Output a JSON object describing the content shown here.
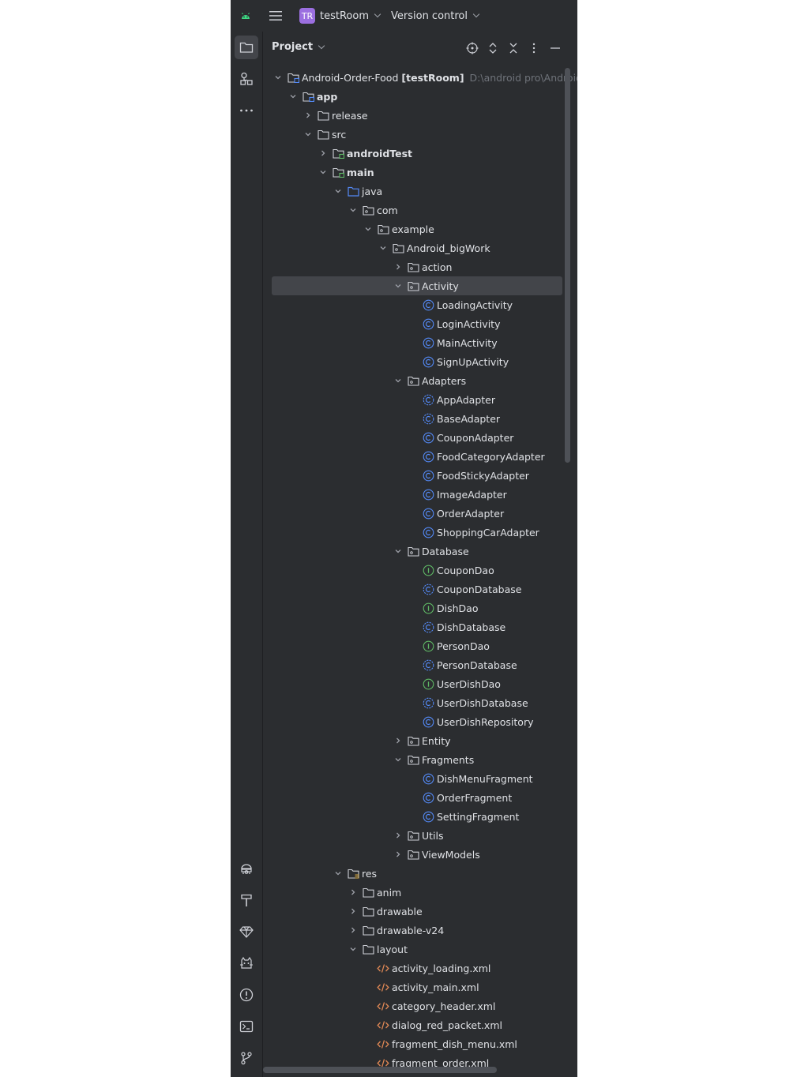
{
  "titlebar": {
    "project_badge": "TR",
    "project_name": "testRoom",
    "vcs_label": "Version control"
  },
  "panel": {
    "title": "Project"
  },
  "tree": [
    {
      "depth": 0,
      "arrow": "down",
      "icon": "module-folder",
      "label": "Android-Order-Food",
      "extra": "[testRoom]",
      "path": "D:\\android pro\\Android"
    },
    {
      "depth": 1,
      "arrow": "down",
      "icon": "module-folder",
      "label": "app",
      "bold": true
    },
    {
      "depth": 2,
      "arrow": "right",
      "icon": "folder",
      "label": "release"
    },
    {
      "depth": 2,
      "arrow": "down",
      "icon": "folder",
      "label": "src"
    },
    {
      "depth": 3,
      "arrow": "right",
      "icon": "source-folder",
      "label": "androidTest",
      "bold": true
    },
    {
      "depth": 3,
      "arrow": "down",
      "icon": "source-folder",
      "label": "main",
      "bold": true
    },
    {
      "depth": 4,
      "arrow": "down",
      "icon": "java-folder",
      "label": "java"
    },
    {
      "depth": 5,
      "arrow": "down",
      "icon": "package",
      "label": "com"
    },
    {
      "depth": 6,
      "arrow": "down",
      "icon": "package",
      "label": "example"
    },
    {
      "depth": 7,
      "arrow": "down",
      "icon": "package",
      "label": "Android_bigWork"
    },
    {
      "depth": 8,
      "arrow": "right",
      "icon": "package",
      "label": "action"
    },
    {
      "depth": 8,
      "arrow": "down",
      "icon": "package",
      "label": "Activity",
      "selected": true
    },
    {
      "depth": 9,
      "arrow": "none",
      "icon": "class",
      "label": "LoadingActivity"
    },
    {
      "depth": 9,
      "arrow": "none",
      "icon": "class",
      "label": "LoginActivity"
    },
    {
      "depth": 9,
      "arrow": "none",
      "icon": "class",
      "label": "MainActivity"
    },
    {
      "depth": 9,
      "arrow": "none",
      "icon": "class",
      "label": "SignUpActivity"
    },
    {
      "depth": 8,
      "arrow": "down",
      "icon": "package",
      "label": "Adapters"
    },
    {
      "depth": 9,
      "arrow": "none",
      "icon": "abstract-class",
      "label": "AppAdapter"
    },
    {
      "depth": 9,
      "arrow": "none",
      "icon": "abstract-class",
      "label": "BaseAdapter"
    },
    {
      "depth": 9,
      "arrow": "none",
      "icon": "class",
      "label": "CouponAdapter"
    },
    {
      "depth": 9,
      "arrow": "none",
      "icon": "class",
      "label": "FoodCategoryAdapter"
    },
    {
      "depth": 9,
      "arrow": "none",
      "icon": "class",
      "label": "FoodStickyAdapter"
    },
    {
      "depth": 9,
      "arrow": "none",
      "icon": "class",
      "label": "ImageAdapter"
    },
    {
      "depth": 9,
      "arrow": "none",
      "icon": "class",
      "label": "OrderAdapter"
    },
    {
      "depth": 9,
      "arrow": "none",
      "icon": "class",
      "label": "ShoppingCarAdapter"
    },
    {
      "depth": 8,
      "arrow": "down",
      "icon": "package",
      "label": "Database"
    },
    {
      "depth": 9,
      "arrow": "none",
      "icon": "interface",
      "label": "CouponDao"
    },
    {
      "depth": 9,
      "arrow": "none",
      "icon": "abstract-class",
      "label": "CouponDatabase"
    },
    {
      "depth": 9,
      "arrow": "none",
      "icon": "interface",
      "label": "DishDao"
    },
    {
      "depth": 9,
      "arrow": "none",
      "icon": "abstract-class",
      "label": "DishDatabase"
    },
    {
      "depth": 9,
      "arrow": "none",
      "icon": "interface",
      "label": "PersonDao"
    },
    {
      "depth": 9,
      "arrow": "none",
      "icon": "abstract-class",
      "label": "PersonDatabase"
    },
    {
      "depth": 9,
      "arrow": "none",
      "icon": "interface",
      "label": "UserDishDao"
    },
    {
      "depth": 9,
      "arrow": "none",
      "icon": "abstract-class",
      "label": "UserDishDatabase"
    },
    {
      "depth": 9,
      "arrow": "none",
      "icon": "class",
      "label": "UserDishRepository"
    },
    {
      "depth": 8,
      "arrow": "right",
      "icon": "package",
      "label": "Entity"
    },
    {
      "depth": 8,
      "arrow": "down",
      "icon": "package",
      "label": "Fragments"
    },
    {
      "depth": 9,
      "arrow": "none",
      "icon": "class",
      "label": "DishMenuFragment"
    },
    {
      "depth": 9,
      "arrow": "none",
      "icon": "class",
      "label": "OrderFragment"
    },
    {
      "depth": 9,
      "arrow": "none",
      "icon": "class",
      "label": "SettingFragment"
    },
    {
      "depth": 8,
      "arrow": "right",
      "icon": "package",
      "label": "Utils"
    },
    {
      "depth": 8,
      "arrow": "right",
      "icon": "package",
      "label": "ViewModels"
    },
    {
      "depth": 4,
      "arrow": "down",
      "icon": "res-folder",
      "label": "res"
    },
    {
      "depth": 5,
      "arrow": "right",
      "icon": "folder",
      "label": "anim"
    },
    {
      "depth": 5,
      "arrow": "right",
      "icon": "folder",
      "label": "drawable"
    },
    {
      "depth": 5,
      "arrow": "right",
      "icon": "folder",
      "label": "drawable-v24"
    },
    {
      "depth": 5,
      "arrow": "down",
      "icon": "folder",
      "label": "layout"
    },
    {
      "depth": 6,
      "arrow": "none",
      "icon": "xml",
      "label": "activity_loading.xml"
    },
    {
      "depth": 6,
      "arrow": "none",
      "icon": "xml",
      "label": "activity_main.xml"
    },
    {
      "depth": 6,
      "arrow": "none",
      "icon": "xml",
      "label": "category_header.xml"
    },
    {
      "depth": 6,
      "arrow": "none",
      "icon": "xml",
      "label": "dialog_red_packet.xml"
    },
    {
      "depth": 6,
      "arrow": "none",
      "icon": "xml",
      "label": "fragment_dish_menu.xml"
    },
    {
      "depth": 6,
      "arrow": "none",
      "icon": "xml",
      "label": "fragment_order.xml"
    }
  ],
  "colors": {
    "background": "#2b2d30",
    "selection": "#43454a",
    "text": "#dfe1e5",
    "class_icon": "#548af7",
    "interface_icon": "#5fb865",
    "xml_icon": "#e08855",
    "android_green": "#3ddc84",
    "project_badge": "#9b6fe0"
  }
}
